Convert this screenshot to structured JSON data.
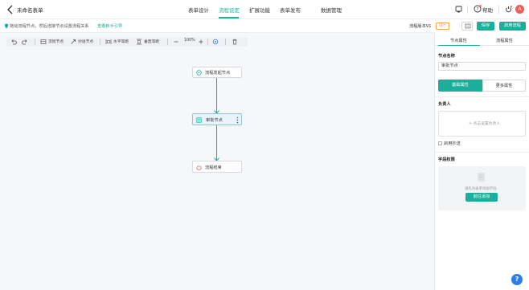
{
  "header": {
    "form_title": "未命名表单",
    "tabs": [
      {
        "label": "表单设计",
        "active": false
      },
      {
        "label": "流程设定",
        "active": true
      },
      {
        "label": "扩展功能",
        "active": false
      },
      {
        "label": "表单发布",
        "active": false
      },
      {
        "label": "数据管理",
        "active": false
      }
    ],
    "help_label": "帮助",
    "avatar_icon": "user-avatar",
    "accent_color": "#1aaf9b"
  },
  "hint_bar": {
    "text": "拖动流程节点，然后连接节点设置流程关系",
    "link": "查看新手引导",
    "version_label": "流程版本V1",
    "version_badge": "设计",
    "save_label": "保存",
    "enable_label": "启用流程"
  },
  "toolbar": {
    "flow_node": "流程节点",
    "cc_node": "抄送节点",
    "align_h": "水平等距",
    "align_v": "垂直等距",
    "zoom": "100%"
  },
  "canvas": {
    "nodes": [
      {
        "label": "流程发起节点",
        "icon": "start-icon"
      },
      {
        "label": "审批节点",
        "icon": "approval-icon",
        "selected": true
      },
      {
        "label": "流程结束",
        "icon": "power-icon"
      }
    ]
  },
  "panel": {
    "tabs": [
      {
        "label": "节点属性",
        "active": true
      },
      {
        "label": "流程属性",
        "active": false
      }
    ],
    "node_name_title": "节点名称",
    "node_name_value": "审批节点",
    "seg_basic": "基础属性",
    "seg_more": "更多属性",
    "assignee_title": "负责人",
    "assignee_placeholder": "+ 点击设置负责人",
    "cc_checkbox_label": "启用抄送",
    "field_perm_title": "字段权限",
    "field_perm_empty": "请先为表单添加字段",
    "add_button": "前往添加"
  }
}
